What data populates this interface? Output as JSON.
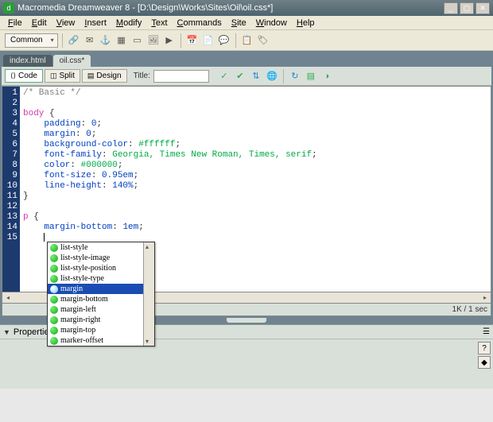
{
  "window": {
    "title": "Macromedia Dreamweaver 8 - [D:\\Design\\Works\\Sites\\Oil\\oil.css*]",
    "app_icon": "dw-icon"
  },
  "menubar": [
    "File",
    "Edit",
    "View",
    "Insert",
    "Modify",
    "Text",
    "Commands",
    "Site",
    "Window",
    "Help"
  ],
  "toolbar": {
    "common_label": "Common"
  },
  "file_tabs": [
    {
      "label": "index.html",
      "active": false
    },
    {
      "label": "oil.css*",
      "active": true
    }
  ],
  "doc_toolbar": {
    "code": "Code",
    "split": "Split",
    "design": "Design",
    "title_label": "Title:"
  },
  "code_lines": [
    {
      "n": 1,
      "html": "<span class='c-cm'>/* Basic */</span>"
    },
    {
      "n": 2,
      "html": ""
    },
    {
      "n": 3,
      "html": "<span class='c-sel'>body</span> {"
    },
    {
      "n": 4,
      "html": "    <span class='c-prop'>padding</span>: <span class='c-num'>0</span>;"
    },
    {
      "n": 5,
      "html": "    <span class='c-prop'>margin</span>: <span class='c-num'>0</span>;"
    },
    {
      "n": 6,
      "html": "    <span class='c-prop'>background-color</span>: <span class='c-val'>#ffffff</span>;"
    },
    {
      "n": 7,
      "html": "    <span class='c-prop'>font-family</span>: <span class='c-val'>Georgia, Times New Roman, Times, serif</span>;"
    },
    {
      "n": 8,
      "html": "    <span class='c-prop'>color</span>: <span class='c-val'>#000000</span>;"
    },
    {
      "n": 9,
      "html": "    <span class='c-prop'>font-size</span>: <span class='c-num'>0.95em</span>;"
    },
    {
      "n": 10,
      "html": "    <span class='c-prop'>line-height</span>: <span class='c-num'>140%</span>;"
    },
    {
      "n": 11,
      "html": "}"
    },
    {
      "n": 12,
      "html": ""
    },
    {
      "n": 13,
      "html": "<span class='c-sel'>p</span> {"
    },
    {
      "n": 14,
      "html": "    <span class='c-prop'>margin-bottom</span>: <span class='c-num'>1em</span>;"
    },
    {
      "n": 15,
      "html": "    <span class='cursor'></span>"
    }
  ],
  "autocomplete": {
    "items": [
      {
        "label": "list-style",
        "selected": false
      },
      {
        "label": "list-style-image",
        "selected": false
      },
      {
        "label": "list-style-position",
        "selected": false
      },
      {
        "label": "list-style-type",
        "selected": false
      },
      {
        "label": "margin",
        "selected": true
      },
      {
        "label": "margin-bottom",
        "selected": false
      },
      {
        "label": "margin-left",
        "selected": false
      },
      {
        "label": "margin-right",
        "selected": false
      },
      {
        "label": "margin-top",
        "selected": false
      },
      {
        "label": "marker-offset",
        "selected": false
      }
    ]
  },
  "statusbar": {
    "pos": "1K / 1 sec"
  },
  "properties": {
    "header": "Properties"
  }
}
